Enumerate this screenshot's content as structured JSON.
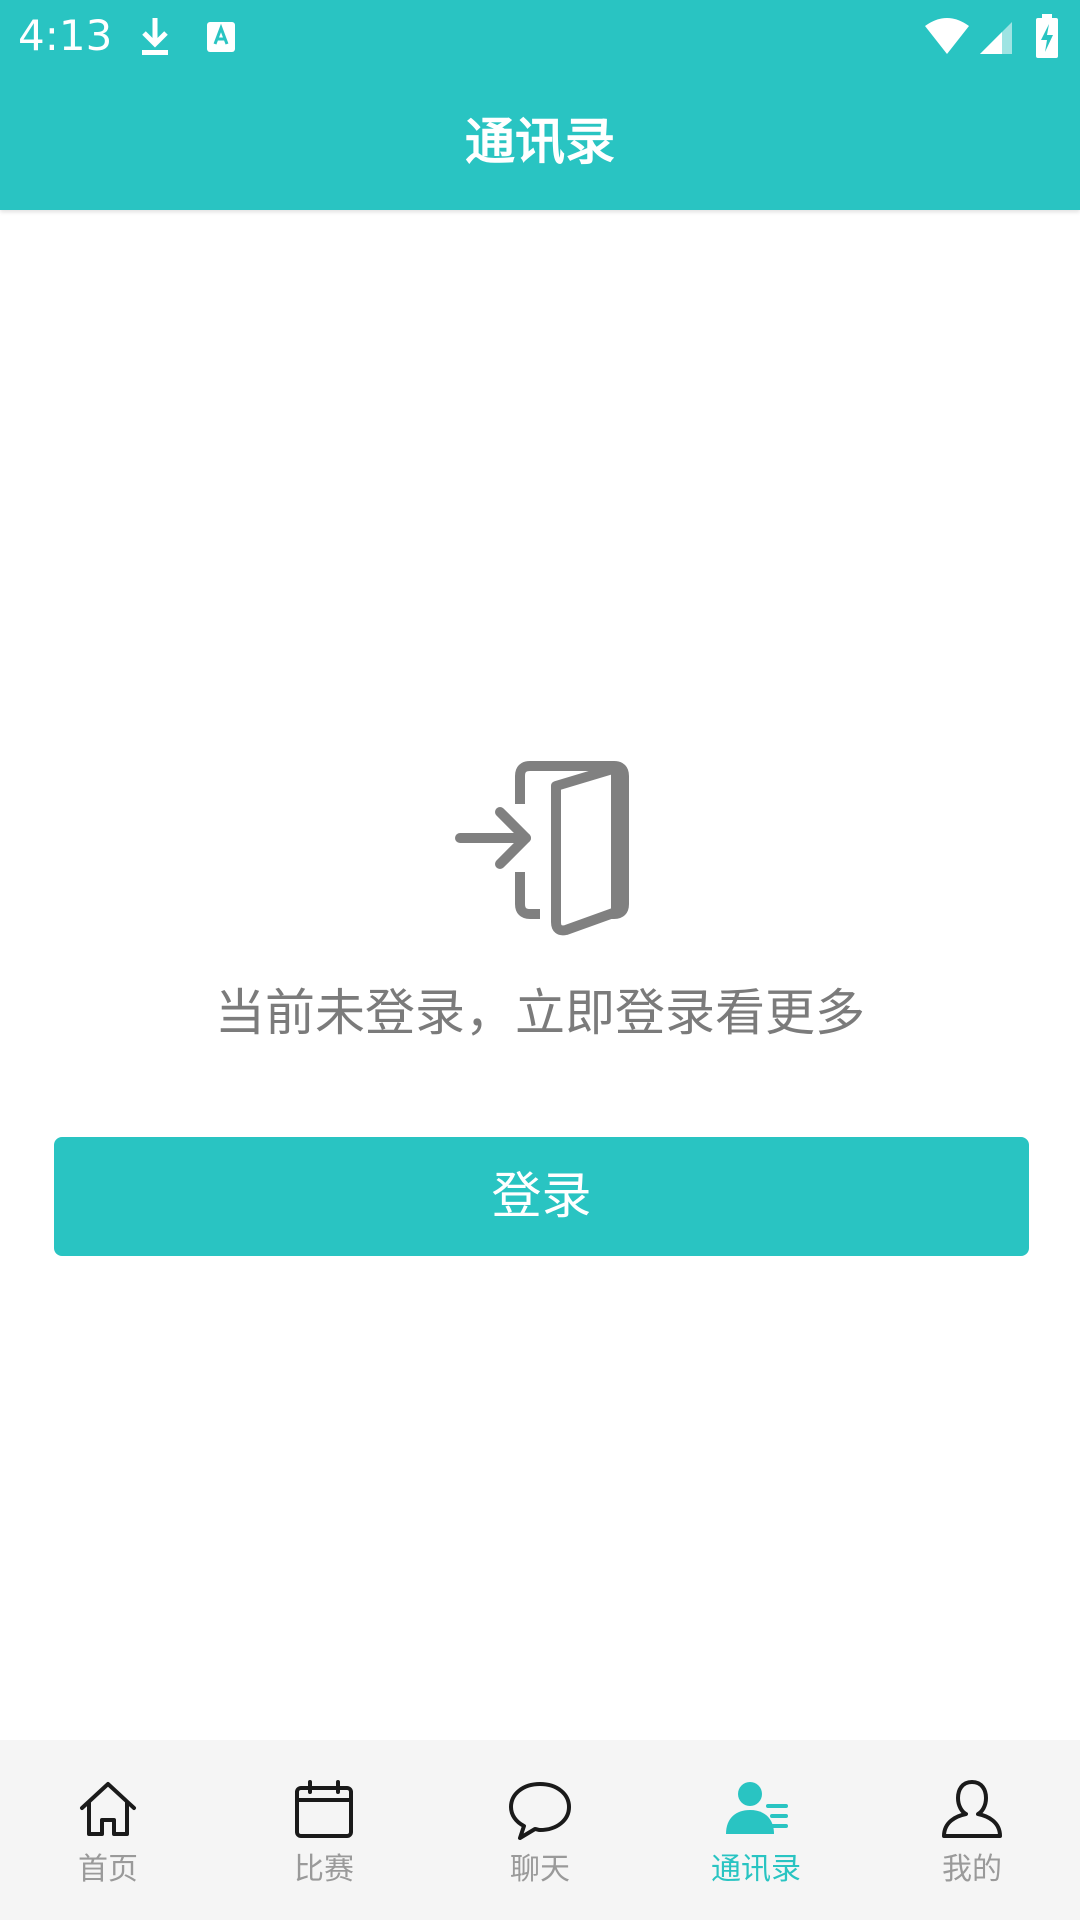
{
  "status_bar": {
    "time": "4:13",
    "left_icons": [
      "download-icon",
      "keyboard-a-icon"
    ],
    "right_icons": [
      "wifi-icon",
      "cellular-signal-icon",
      "battery-charging-icon"
    ]
  },
  "header": {
    "title": "通讯录"
  },
  "empty_state": {
    "icon": "login-door-icon",
    "message": "当前未登录，立即登录看更多",
    "button_label": "登录"
  },
  "bottom_nav": {
    "items": [
      {
        "label": "首页",
        "icon": "home-icon",
        "active": false
      },
      {
        "label": "比赛",
        "icon": "calendar-icon",
        "active": false
      },
      {
        "label": "聊天",
        "icon": "chat-bubble-icon",
        "active": false
      },
      {
        "label": "通讯录",
        "icon": "contacts-icon",
        "active": true
      },
      {
        "label": "我的",
        "icon": "person-icon",
        "active": false
      }
    ]
  },
  "colors": {
    "accent": "#29c4c2",
    "text_muted": "#7b7b7b",
    "nav_inactive": "#9a9a9a",
    "nav_background": "#f5f5f5"
  }
}
